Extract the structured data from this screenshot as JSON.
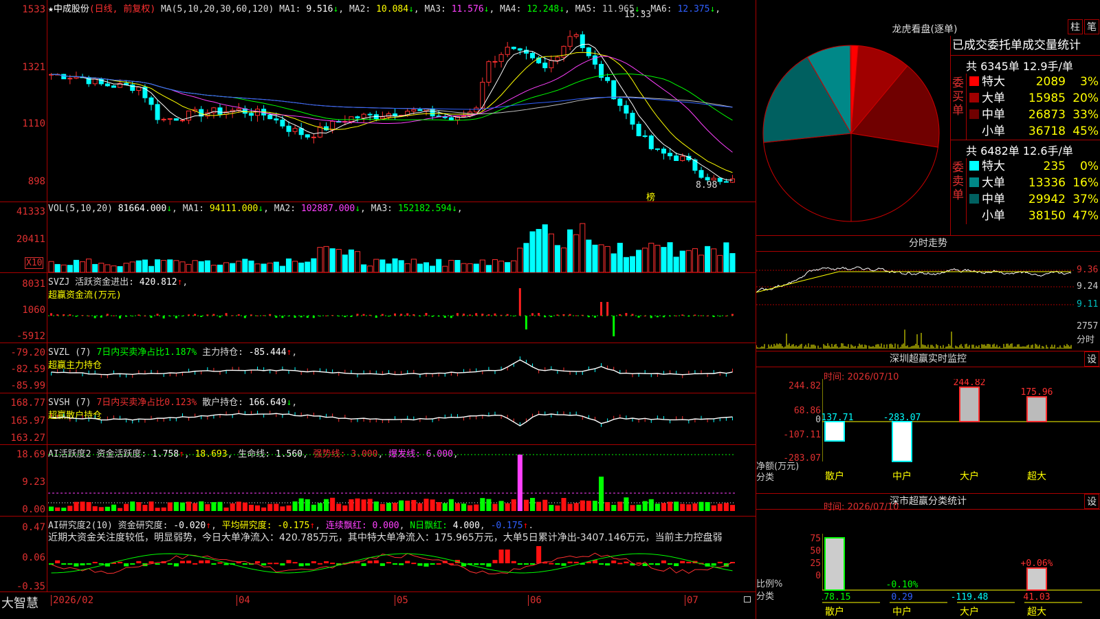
{
  "stock": {
    "name": "中成股份",
    "mode": "(日线, 前复权)",
    "star": "★"
  },
  "main": {
    "ma_header": "MA(5,10,20,30,60,120)",
    "ma": [
      {
        "label": "MA1:",
        "value": "9.516",
        "arrow": "↓",
        "color": "#ffffff"
      },
      {
        "label": "MA2:",
        "value": "10.084",
        "arrow": "↓",
        "color": "#ffff00"
      },
      {
        "label": "MA3:",
        "value": "11.576",
        "arrow": "↓",
        "color": "#ff40ff"
      },
      {
        "label": "MA4:",
        "value": "12.248",
        "arrow": "↓",
        "color": "#00ff00"
      },
      {
        "label": "MA5:",
        "value": "11.965",
        "arrow": "↓",
        "color": "#c0c0c0"
      },
      {
        "label": "MA6:",
        "value": "12.375",
        "arrow": "↓",
        "color": "#3060ff"
      }
    ],
    "y_ticks": [
      "1533",
      "1321",
      "1110",
      "898"
    ],
    "high_label": "15.33",
    "low_label": "8.98",
    "bang": "榜"
  },
  "vol": {
    "header": "VOL(5,10,20)",
    "value": "81664.000",
    "arrow": "↓",
    "ma": [
      {
        "label": "MA1:",
        "value": "94111.000",
        "arrow": "↓",
        "color": "#ffff00"
      },
      {
        "label": "MA2:",
        "value": "102887.000",
        "arrow": "↓",
        "color": "#ff40ff"
      },
      {
        "label": "MA3:",
        "value": "152182.594",
        "arrow": "↓",
        "color": "#00ff00"
      }
    ],
    "y_ticks": [
      "41333",
      "20411"
    ],
    "unit": "X10"
  },
  "svzj": {
    "name": "SVZJ",
    "text": "活跃资金进出:",
    "value": "420.812",
    "arrow": "↑",
    "line2": "超赢资金流(万元)",
    "y_ticks": [
      "8031",
      "1060",
      "-5912"
    ]
  },
  "svzl": {
    "name": "SVZL",
    "param": "(7)",
    "pct_text": "7日内买卖净占比1.187%",
    "hold": "主力持仓:",
    "value": "-85.444",
    "arrow": "↑",
    "line2": "超赢主力持仓",
    "y_ticks": [
      "-79.20",
      "-82.59",
      "-85.99"
    ]
  },
  "svsh": {
    "name": "SVSH",
    "param": "(7)",
    "pct_text": "7日内买卖净占比0.123%",
    "hold": "散户持仓:",
    "value": "166.649",
    "arrow": "↓",
    "line2": "超赢散户持仓",
    "y_ticks": [
      "168.77",
      "165.97",
      "163.27"
    ]
  },
  "ai1": {
    "name": "AI活跃度2",
    "t1": "资金活跃度:",
    "v1": "1.758",
    "a1": "↑",
    "v2": "18.693",
    "t3": "生命线:",
    "v3": "1.560",
    "t4": "强势线:",
    "v4": "3.000",
    "t5": "爆发线:",
    "v5": "6.000",
    "y_ticks": [
      "18.69",
      "9.23",
      "0.00"
    ]
  },
  "ai2": {
    "name": "AI研究度2(10)",
    "t1": "资金研究度:",
    "v1": "-0.020",
    "a1": "↑",
    "t2": "平均研究度:",
    "v2": "-0.175",
    "a2": "↑",
    "t3": "连续飘红:",
    "v3": "0.000",
    "t4": "N日飘红:",
    "v4": "4.000",
    "v5": "-0.175",
    "a5": "↑",
    "desc": "近期大资金关注度较低，明显弱势，今日大单净流入：420.785万元，其中特大单净流入：175.965万元，大单5日累计净出-3407.146万元，当前主力控盘弱",
    "y_ticks": [
      "0.47",
      "0.06",
      "-0.35"
    ]
  },
  "xaxis": {
    "brand": "大智慧",
    "labels": [
      "2026/02",
      "04",
      "05",
      "06",
      "07"
    ]
  },
  "lhb": {
    "title": "龙虎看盘(逐单)",
    "btn1": "柱",
    "btn2": "笔",
    "table_title": "已成交委托单成交量统计",
    "buy": {
      "side": "委买单",
      "summary": "共 6345单 12.9手/单",
      "rows": [
        {
          "name": "特大",
          "vol": "2089",
          "pct": "3%",
          "color": "#ff0000"
        },
        {
          "name": "大单",
          "vol": "15985",
          "pct": "20%",
          "color": "#a00000"
        },
        {
          "name": "中单",
          "vol": "26873",
          "pct": "33%",
          "color": "#700000"
        },
        {
          "name": "小单",
          "vol": "36718",
          "pct": "45%",
          "color": "#000000"
        }
      ]
    },
    "sell": {
      "side": "委卖单",
      "summary": "共 6482单 12.6手/单",
      "rows": [
        {
          "name": "特大",
          "vol": "235",
          "pct": "0%",
          "color": "#00ffff"
        },
        {
          "name": "大单",
          "vol": "13336",
          "pct": "16%",
          "color": "#008888"
        },
        {
          "name": "中单",
          "vol": "29942",
          "pct": "37%",
          "color": "#006060"
        },
        {
          "name": "小单",
          "vol": "38150",
          "pct": "47%",
          "color": "#000000"
        }
      ]
    }
  },
  "fenshi": {
    "title": "分时走势",
    "y_ticks": [
      "9.36",
      "9.24",
      "9.11"
    ],
    "vol_tick": "2757",
    "vol_unit": "分时"
  },
  "szmon": {
    "title": "深圳超赢实时监控",
    "btn": "设",
    "time": "时间: 2026/07/10",
    "y_ticks": [
      "244.82",
      "68.86",
      "0",
      "-107.11",
      "-283.07"
    ],
    "ylab1": "净额(万元)",
    "ylab2": "分类",
    "bars": [
      {
        "cat": "散户",
        "value": "-137.71"
      },
      {
        "cat": "中户",
        "value": "-283.07"
      },
      {
        "cat": "大户",
        "value": "244.82"
      },
      {
        "cat": "超大",
        "value": "175.96"
      }
    ]
  },
  "szcls": {
    "title": "深市超赢分类统计",
    "btn": "设",
    "time": "时间: 2026/07/10",
    "y_ticks": [
      "75",
      "50",
      "25",
      "0"
    ],
    "ylab1": "比例%",
    "ylab2": "分类",
    "top": [
      {
        "cat": "散户",
        "label": ""
      },
      {
        "cat": "中户",
        "label": "-0.10%"
      },
      {
        "cat": "大户",
        "label": ""
      },
      {
        "cat": "超大",
        "label": "+0.06%"
      }
    ],
    "bottom": [
      "178.15",
      "0.29",
      "-119.48",
      "41.03"
    ],
    "cats": [
      "散户",
      "中户",
      "大户",
      "超大"
    ]
  }
}
